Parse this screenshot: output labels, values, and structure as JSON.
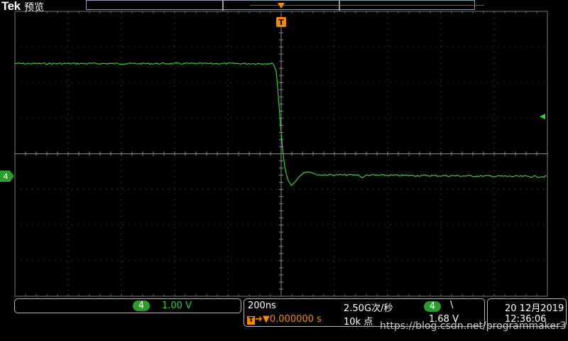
{
  "header": {
    "brand": "Tek",
    "mode": "预览"
  },
  "markers": {
    "trigger_top": "T",
    "channel_level": "4"
  },
  "channel": {
    "number": "4",
    "scale": "1.00 V",
    "color": "#3cc93c"
  },
  "timebase": {
    "time_per_div": "200ns",
    "sample_rate": "2.50G次/秒",
    "trigger_position": "0.000000 s",
    "record_length": "10k 点"
  },
  "trigger": {
    "source": "4",
    "slope": "\\",
    "level": "1.68 V"
  },
  "datetime": {
    "date": "20 12月2019",
    "time": "12:36:06"
  },
  "watermark": "https://blog.csdn.net/programmaker3",
  "colors": {
    "trace": "#3cc93c",
    "trigger": "#f08c00",
    "grid": "#555555"
  }
}
